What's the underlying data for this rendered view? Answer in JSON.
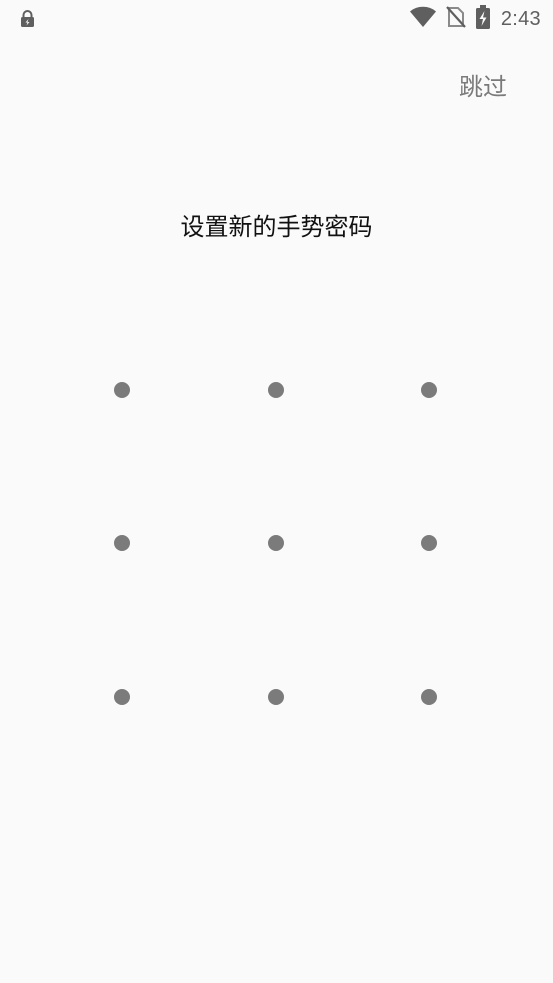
{
  "status_bar": {
    "time": "2:43",
    "icons": [
      "lock-icon",
      "wifi-icon",
      "no-sim-icon",
      "battery-charging-icon"
    ]
  },
  "header": {
    "skip_label": "跳过"
  },
  "main": {
    "title": "设置新的手势密码",
    "pattern": {
      "rows": 3,
      "cols": 3,
      "dot_color": "#7b7b7b"
    }
  }
}
